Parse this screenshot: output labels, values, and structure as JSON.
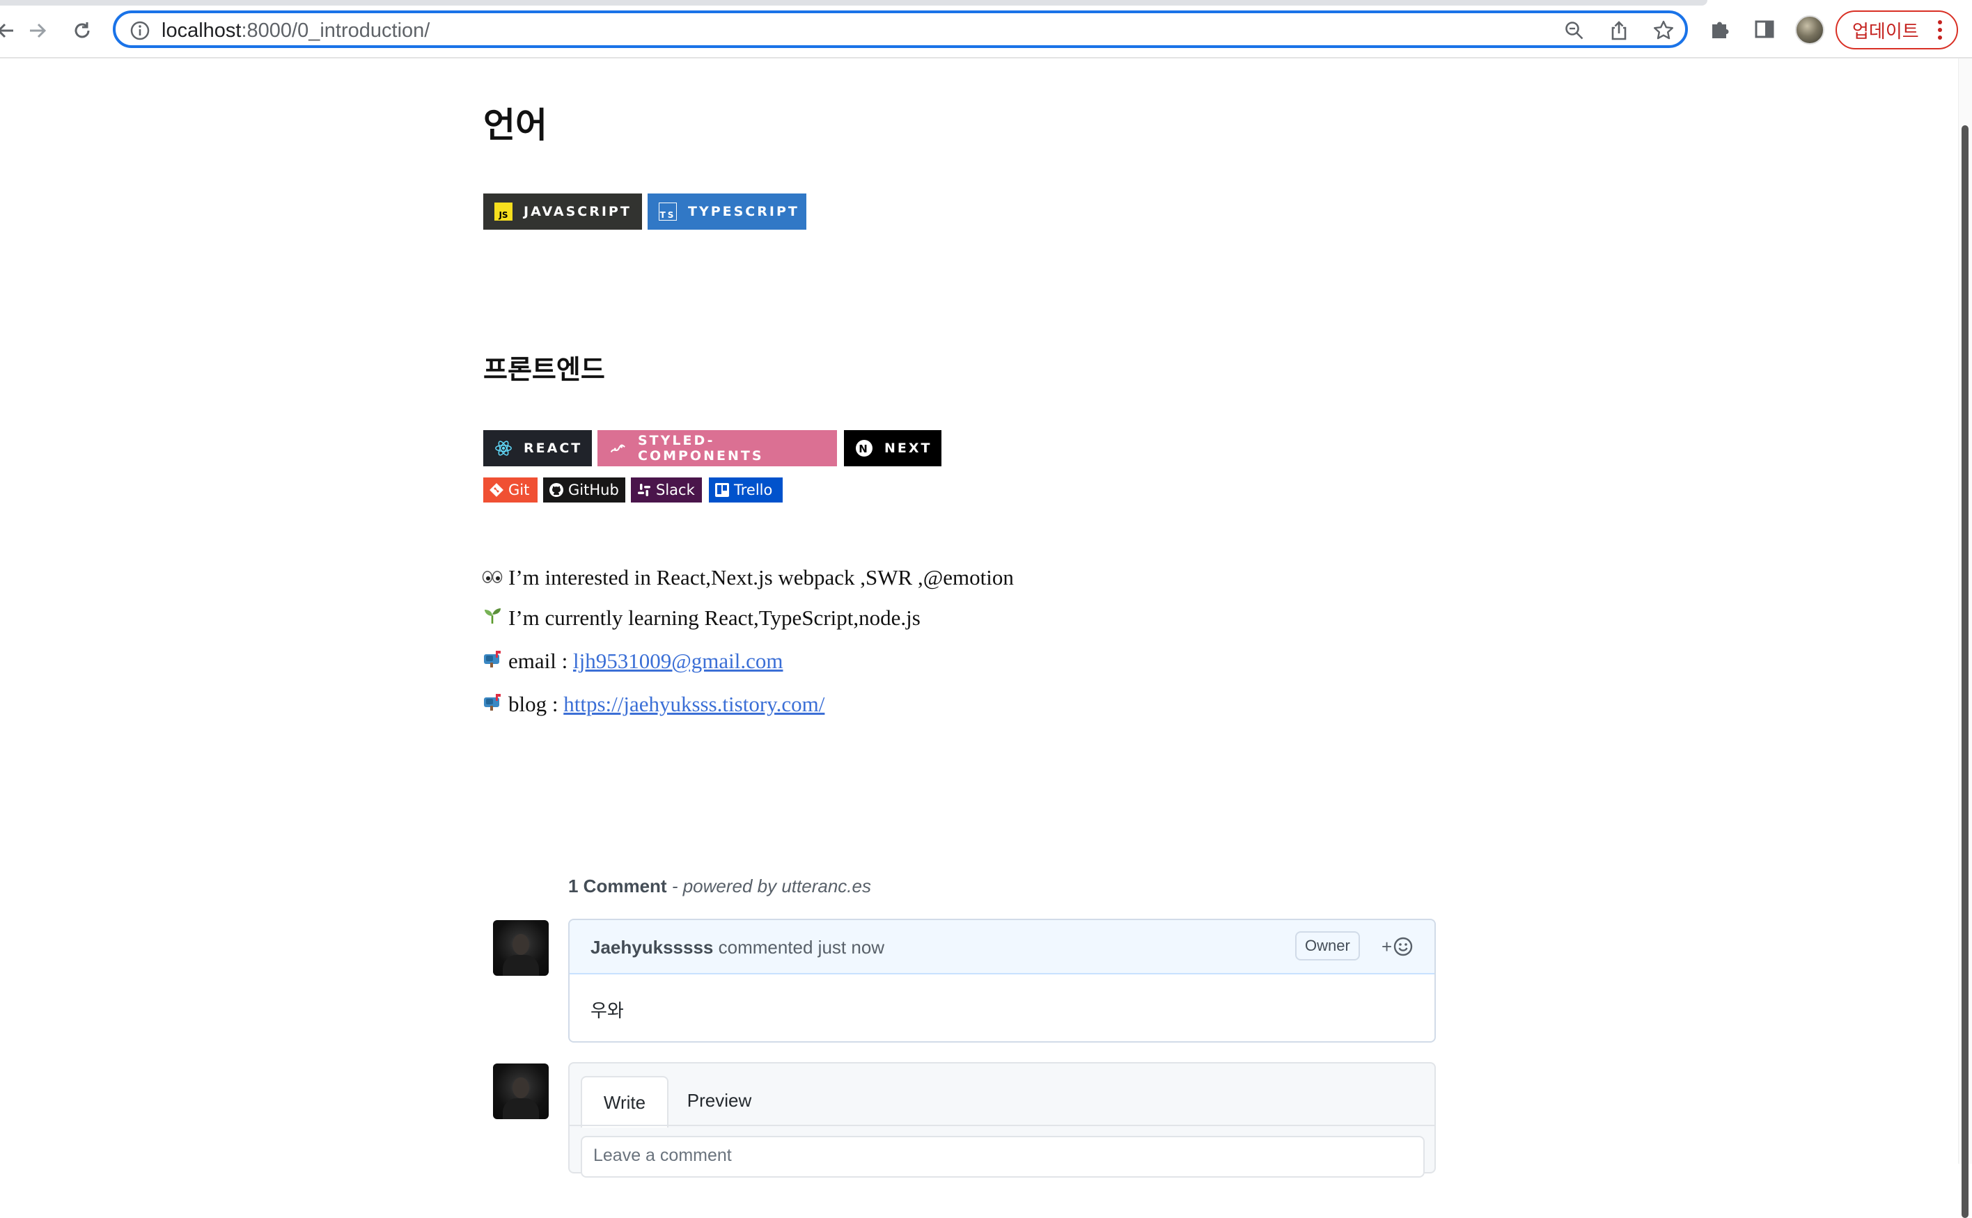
{
  "browser": {
    "url_host": "localhost",
    "url_path": ":8000/0_introduction/",
    "update_label": "업데이트"
  },
  "sections": {
    "languages_title": "언어",
    "frontend_title": "프론트엔드"
  },
  "badges": {
    "javascript": {
      "label": "JAVASCRIPT",
      "icon_text": "JS",
      "color": "#323330"
    },
    "typescript": {
      "label": "TYPESCRIPT",
      "icon_text": "TS",
      "color": "#3178c6"
    },
    "react": {
      "label": "REACT",
      "color": "#20232a"
    },
    "styled_components": {
      "label": "STYLED-COMPONENTS",
      "color": "#db7093"
    },
    "next": {
      "label": "NEXT",
      "icon_text": "N",
      "color": "#000000"
    }
  },
  "tools": [
    {
      "label": "Git",
      "color": "#f05033"
    },
    {
      "label": "GitHub",
      "color": "#181717"
    },
    {
      "label": "Slack",
      "color": "#4a154b"
    },
    {
      "label": "Trello",
      "color": "#0052cc"
    }
  ],
  "intro": {
    "interested": "I’m interested in React,Next.js webpack ,SWR ,@emotion",
    "learning": "I’m currently learning React,TypeScript,node.js",
    "email_prefix": "email :",
    "email": "ljh9531009@gmail.com",
    "blog_prefix": "blog :",
    "blog": "https://jaehyuksss.tistory.com/"
  },
  "comments": {
    "count_label": "1 Comment",
    "powered_by": "- powered by utteranc.es",
    "author": "Jaehyuksssss",
    "action": "commented just now",
    "owner_label": "Owner",
    "reaction_plus": "+",
    "body": "우와",
    "tab_write": "Write",
    "tab_preview": "Preview",
    "placeholder": "Leave a comment"
  }
}
